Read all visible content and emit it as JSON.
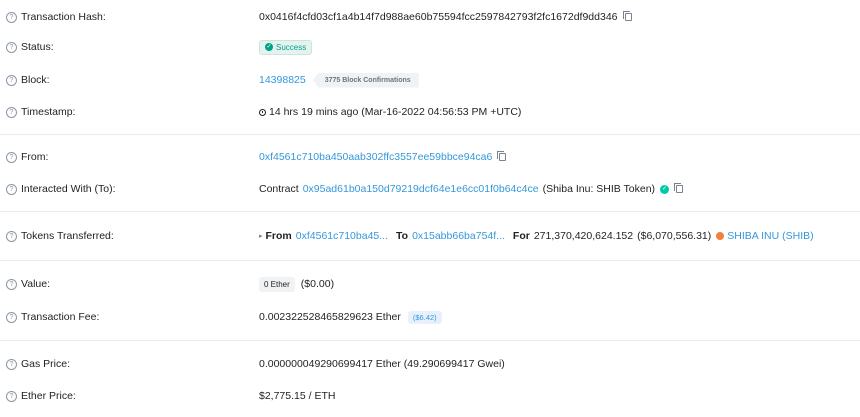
{
  "rows": {
    "tx_hash": {
      "label": "Transaction Hash:",
      "value": "0x0416f4cfd03cf1a4b14f7d988ae60b75594fcc2597842793f2fc1672df9dd346"
    },
    "status": {
      "label": "Status:",
      "value": "Success"
    },
    "block": {
      "label": "Block:",
      "value": "14398825",
      "confirmations": "3775 Block Confirmations"
    },
    "timestamp": {
      "label": "Timestamp:",
      "value": "14 hrs 19 mins ago (Mar-16-2022 04:56:53 PM +UTC)"
    },
    "from": {
      "label": "From:",
      "value": "0xf4561c710ba450aab302ffc3557ee59bbce94ca6"
    },
    "interacted": {
      "label": "Interacted With (To):",
      "prefix": "Contract",
      "address": "0x95ad61b0a150d79219dcf64e1e6cc01f0b64c4ce",
      "name": "(Shiba Inu: SHIB Token)"
    },
    "tokens": {
      "label": "Tokens Transferred:",
      "from_label": "From",
      "from_addr": "0xf4561c710ba45...",
      "to_label": "To",
      "to_addr": "0x15abb66ba754f...",
      "for_label": "For",
      "amount": "271,370,420,624.152",
      "usd": "($6,070,556.31)",
      "token": "SHIBA INU (SHIB)"
    },
    "value": {
      "label": "Value:",
      "badge": "0 Ether",
      "usd": "($0.00)"
    },
    "fee": {
      "label": "Transaction Fee:",
      "value": "0.002322528465829623 Ether",
      "usd": "($6.42)"
    },
    "gas": {
      "label": "Gas Price:",
      "value": "0.000000049290699417 Ether (49.290699417 Gwei)"
    },
    "ether_price": {
      "label": "Ether Price:",
      "value": "$2,775.15 / ETH"
    }
  },
  "help_glyph": "?",
  "colors": {
    "link": "#3498db",
    "success": "#00a186",
    "separator": "#e7eaf3"
  }
}
